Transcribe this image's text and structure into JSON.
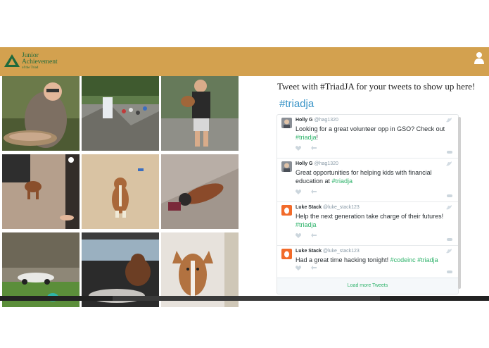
{
  "header": {
    "logo": {
      "line1": "Junior",
      "line2": "Achievement",
      "line3": "of the Triad"
    },
    "user_icon": "user-icon"
  },
  "gallery": {
    "photos": [
      "man-holding-fish",
      "waterfall-crowd",
      "man-holding-puppy",
      "dog-on-carpet",
      "puppy-sitting",
      "dog-lying-down",
      "car-on-lawn",
      "dog-in-car",
      "puppy-portrait"
    ]
  },
  "twitter": {
    "heading": "Tweet with #TriadJA for your tweets to show up here!",
    "widget_title": "#triadja",
    "tweets": [
      {
        "name": "Holly G",
        "handle": "@hag1320",
        "text": "Looking for a great volunteer opp in GSO? Check out ",
        "tag1": "#triadja",
        "tail": "!"
      },
      {
        "name": "Holly G",
        "handle": "@hag1320",
        "text": "Great opportunities for helping kids with financial education at ",
        "tag1": "#triadja",
        "tail": ""
      },
      {
        "name": "Luke Stack",
        "handle": "@luke_stack123",
        "text": "Help the next generation take charge of their futures! ",
        "tag1": "#triadja",
        "tail": ""
      },
      {
        "name": "Luke Stack",
        "handle": "@luke_stack123",
        "text": "Had a great time hacking tonight! ",
        "tag1": "#codeinc",
        "tag2": "#triadja",
        "tail": ""
      }
    ],
    "load_more": "Load more Tweets"
  },
  "colors": {
    "header": "#d3a14f",
    "brand_green": "#1f6a3c",
    "hashtag_blue": "#3a94c7",
    "tweet_tag": "#2fb36b"
  }
}
